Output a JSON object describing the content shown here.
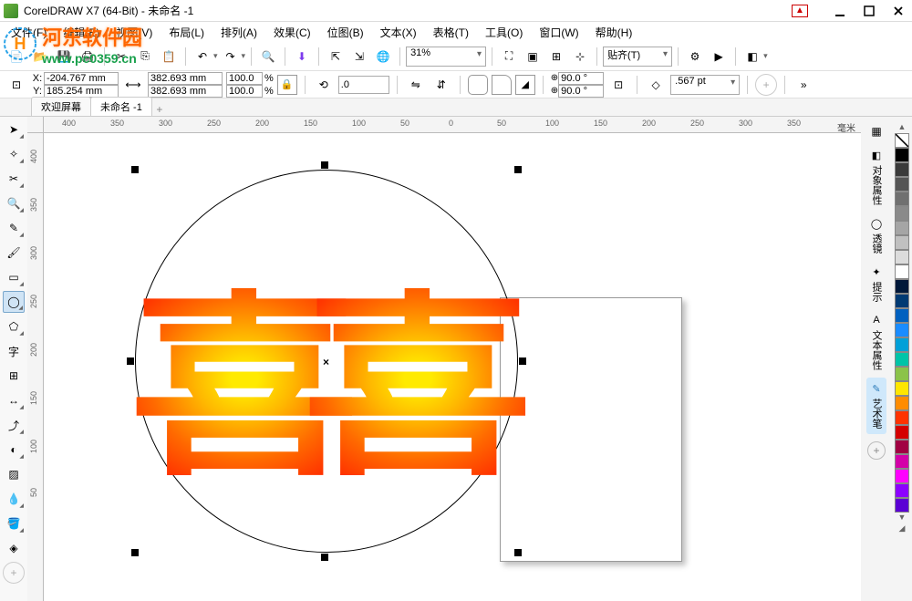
{
  "titlebar": {
    "title": "CorelDRAW X7 (64-Bit) - 未命名 -1"
  },
  "menu": {
    "file": "文件(F)",
    "edit": "编辑(E)",
    "view": "视图(V)",
    "layout": "布局(L)",
    "arrange": "排列(A)",
    "effects": "效果(C)",
    "bitmaps": "位图(B)",
    "text": "文本(X)",
    "table": "表格(T)",
    "tools": "工具(O)",
    "window": "窗口(W)",
    "help": "帮助(H)"
  },
  "watermark": {
    "logo": "河东软件园",
    "url": "www.pc0359.cn"
  },
  "toolbar": {
    "zoom": "31%",
    "snap": "贴齐(T)"
  },
  "propbar": {
    "x": "-204.767 mm",
    "y": "185.254 mm",
    "w": "382.693 mm",
    "h": "382.693 mm",
    "sx": "100.0",
    "sy": "100.0",
    "angle": ".0",
    "rot1": "90.0 °",
    "rot2": "90.0 °",
    "outline": ".567 pt"
  },
  "tabs": {
    "welcome": "欢迎屏幕",
    "doc1": "未命名 -1"
  },
  "ruler": {
    "unit": "毫米",
    "h": [
      "400",
      "350",
      "300",
      "250",
      "200",
      "150",
      "100",
      "50",
      "0",
      "50",
      "100",
      "150",
      "200",
      "250",
      "300",
      "350"
    ],
    "v": [
      "400",
      "350",
      "300",
      "250",
      "200",
      "150",
      "100",
      "50"
    ]
  },
  "dockers": {
    "objprops": "对象属性",
    "lens": "透镜",
    "hints": "提示",
    "textprops": "文本属性",
    "artpen": "艺术笔"
  },
  "palette": [
    "#000000",
    "#3a3a3a",
    "#555555",
    "#707070",
    "#8a8a8a",
    "#a5a5a5",
    "#c0c0c0",
    "#dcdcdc",
    "#ffffff",
    "#00183a",
    "#003a73",
    "#0060bf",
    "#1a8cff",
    "#00a0d8",
    "#00c4a8",
    "#8bc34a",
    "#ffe600",
    "#ff8c00",
    "#ff3300",
    "#d40000",
    "#a10042",
    "#d400a8",
    "#ff00ff",
    "#8c00ff",
    "#5a00d4"
  ]
}
